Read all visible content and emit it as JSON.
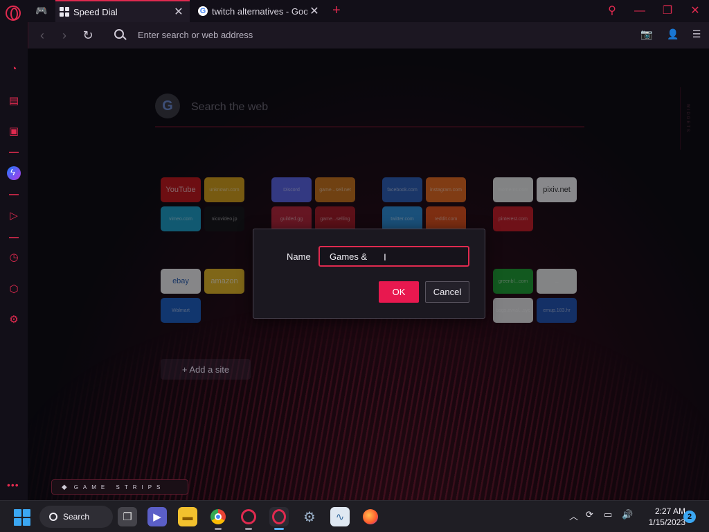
{
  "browser": {
    "tabs": [
      {
        "title": "Speed Dial",
        "active": true,
        "icon": "speed-dial-grid-icon"
      },
      {
        "title": "twitch alternatives - Google",
        "active": false,
        "icon": "google-favicon-icon"
      }
    ],
    "address_placeholder": "Enter search or web address"
  },
  "speed_dial": {
    "search_placeholder": "Search the web",
    "widgets_label": "WIDGETS",
    "groups": [
      {
        "tiles": [
          {
            "label": "YouTube",
            "color": "#c4171b"
          },
          {
            "label": "unknown.com",
            "color": "#d6a018"
          },
          {
            "label": "vimeo.com",
            "color": "#1c9ec7"
          },
          {
            "label": "nicovideo.jp",
            "color": "#151517"
          }
        ]
      },
      {
        "tiles": [
          {
            "label": "Discord",
            "color": "#5a64e6"
          },
          {
            "label": "game...sell.net",
            "color": "#c9731a"
          },
          {
            "label": "guilded.gg",
            "color": "#b7263a"
          },
          {
            "label": "game...selling",
            "color": "#a41a25"
          }
        ]
      },
      {
        "tiles": [
          {
            "label": "facebook.com",
            "color": "#2c5fb6"
          },
          {
            "label": "instagram.com",
            "color": "#e56a1e"
          },
          {
            "label": "twitter.com",
            "color": "#2c8fd8"
          },
          {
            "label": "reddit.com",
            "color": "#e0511b"
          }
        ]
      },
      {
        "tiles": [
          {
            "label": "moments.com",
            "color": "#e9ece9"
          },
          {
            "label": "pixiv.net",
            "color": "#f4f4f6"
          },
          {
            "label": "pinterest.com",
            "color": "#c71c26"
          }
        ]
      },
      {
        "tiles": [
          {
            "label": "ebay",
            "color": "#f0f0f0"
          },
          {
            "label": "amazon",
            "color": "#e3b625"
          },
          {
            "label": "Walmart",
            "color": "#1d5fc1"
          }
        ]
      },
      {
        "tiles": [
          {
            "label": "greenbl...com",
            "color": "#1e9e32"
          },
          {
            "label": "...",
            "color": "#ecedec"
          },
          {
            "label": "bags.avval...syc",
            "color": "#e8e8e8"
          },
          {
            "label": "emup.183.hr",
            "color": "#2254b3"
          }
        ]
      }
    ],
    "add_site_label": "+ Add a site",
    "game_strips_label": "GAME STRIPS"
  },
  "dialog": {
    "name_label": "Name",
    "name_value": "Games & ",
    "ok_label": "OK",
    "cancel_label": "Cancel"
  },
  "taskbar": {
    "search_label": "Search",
    "apps": [
      "task-view",
      "teams-meet",
      "file-explorer",
      "chrome",
      "opera-gx-setup",
      "opera-gx",
      "settings",
      "resource-monitor",
      "firefox"
    ],
    "time": "2:27 AM",
    "date": "1/15/2023",
    "notification_count": "2"
  },
  "colors": {
    "accent": "#e02a4f",
    "ok_button": "#e8184f",
    "background": "#0b0a10"
  }
}
